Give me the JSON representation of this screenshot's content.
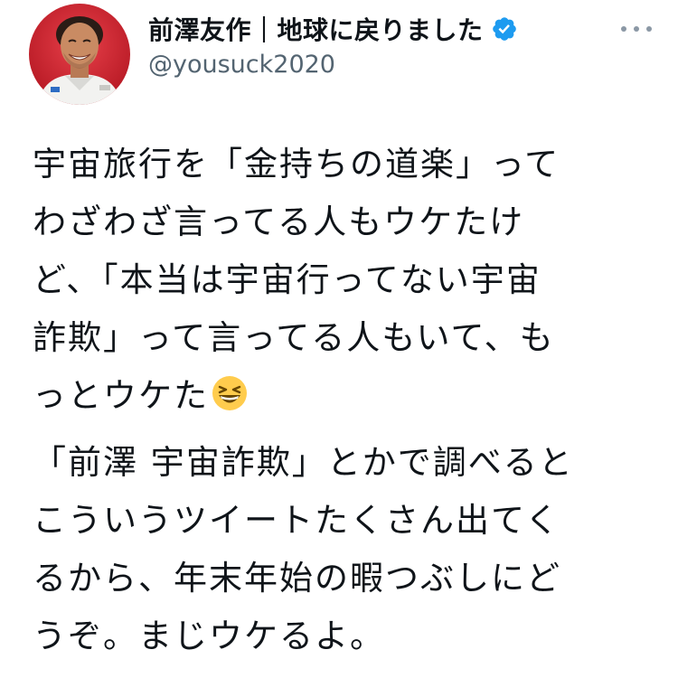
{
  "tweet": {
    "author": {
      "display_name": "前澤友作｜地球に戻りました",
      "username": "@yousuck2020",
      "verified": true,
      "avatar": "profile-photo"
    },
    "more_icon": "more-horizontal-icon",
    "body": {
      "paragraph_1": "宇宙旅行を「金持ちの道楽」って\nわざわざ言ってる人もウケたけ\nど、「本当は宇宙行ってない宇宙\n詐欺」って言ってる人もいて、も\nっとウケた",
      "paragraph_1_emoji": "grinning-squinting-face-emoji",
      "paragraph_2": "「前澤 宇宙詐欺」とかで調べると\nこういうツイートたくさん出てく\nるから、年末年始の暇つぶしにど\nうぞ。まじウケるよ。"
    },
    "colors": {
      "text": "#0f1419",
      "secondary_text": "#536471",
      "verified_badge": "#1d9bf0",
      "more_icon": "#8b98a5"
    }
  }
}
